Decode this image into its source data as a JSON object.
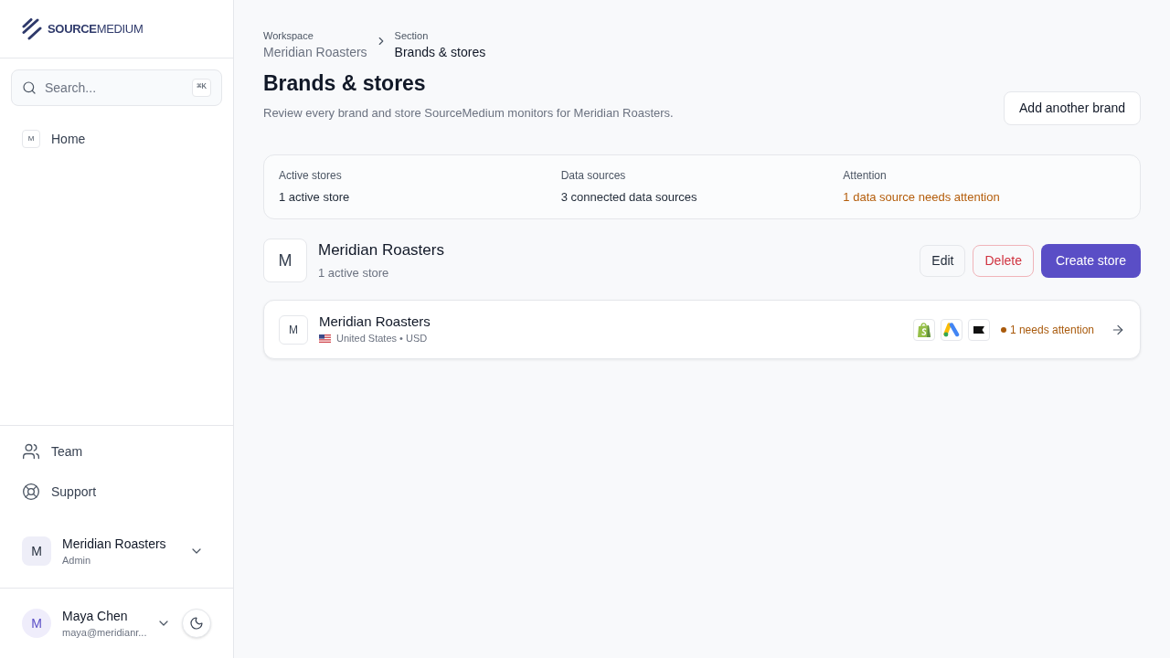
{
  "sidebar": {
    "logo": "**SOURCE**MEDIUM",
    "search": {
      "placeholder": "Search...",
      "shortcut": "⌘K"
    },
    "nav": [
      {
        "kind": "badge",
        "badge": "M",
        "label": "Home"
      }
    ],
    "footer_nav": [
      {
        "kind": "team",
        "label": "Team"
      },
      {
        "kind": "support",
        "label": "Support"
      }
    ],
    "workspace": {
      "avatar": "M",
      "name": "Meridian Roasters",
      "role": "Admin"
    },
    "user": {
      "avatar": "M",
      "name": "Maya Chen",
      "email": "maya@meridianr..."
    }
  },
  "breadcrumb": [
    {
      "caption": "Workspace",
      "label": "Meridian Roasters",
      "current": false
    },
    {
      "caption": "Section",
      "label": "Brands & stores",
      "current": true
    }
  ],
  "header": {
    "title": "Brands & stores",
    "subtitle": "Review every brand and store SourceMedium monitors for Meridian Roasters.",
    "action": "Add another brand"
  },
  "stats": [
    {
      "label": "Active stores",
      "value": "1 active store",
      "kind": "normal"
    },
    {
      "label": "Data sources",
      "value": "3 connected data sources",
      "kind": "normal"
    },
    {
      "label": "Attention",
      "value": "1 data source needs attention",
      "kind": "warning"
    }
  ],
  "brands": [
    {
      "avatar": "M",
      "name": "Meridian Roasters",
      "summary": "1 active store",
      "actions": [
        {
          "kind": "secondary",
          "label": "Edit"
        },
        {
          "kind": "danger",
          "label": "Delete"
        },
        {
          "kind": "primary",
          "label": "Create store"
        }
      ],
      "stores": [
        {
          "avatar": "M",
          "name": "Meridian Roasters",
          "location": "United States • USD",
          "status": {
            "kind": "warning",
            "label": "1 needs attention"
          }
        }
      ]
    }
  ]
}
